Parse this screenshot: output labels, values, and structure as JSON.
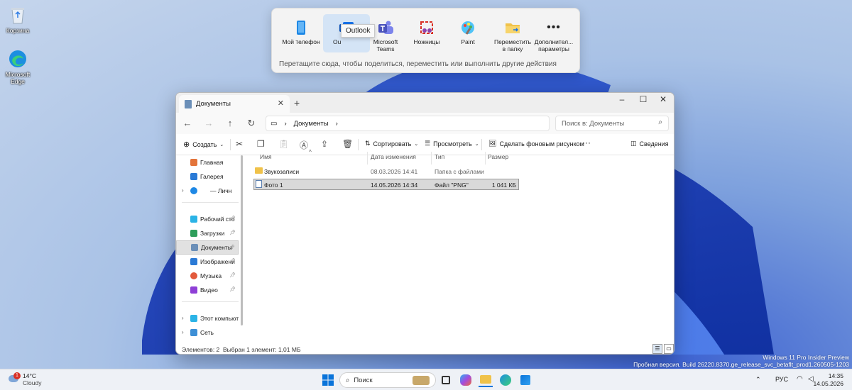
{
  "desktop": {
    "icons": [
      {
        "label": "Корзина",
        "icon": "recycle-bin-icon"
      },
      {
        "label": "Microsoft Edge",
        "icon": "edge-icon"
      }
    ],
    "watermark": {
      "line1": "Windows 11 Pro Insider Preview",
      "line2": "Пробная версия. Build 26220.8370.ge_release_svc_betaflt_prod1.260505-1203"
    }
  },
  "share": {
    "targets": [
      {
        "label": "Мой телефон",
        "icon": "phone-icon"
      },
      {
        "label": "Outlook",
        "icon": "outlook-icon",
        "selected": true
      },
      {
        "label": "Microsoft Teams",
        "icon": "teams-icon"
      },
      {
        "label": "Ножницы",
        "icon": "scissors-icon"
      },
      {
        "label": "Paint",
        "icon": "paint-icon"
      },
      {
        "label": "Переместить в папку",
        "icon": "folder-icon"
      },
      {
        "label": "Дополнительные параметры",
        "icon": "more-icon"
      }
    ],
    "short_label_outlook": "Ou",
    "label_more_line1": "Дополнител...",
    "label_more_line2": "параметры",
    "label_teams_line1": "Microsoft",
    "label_teams_line2": "Teams",
    "label_move_line1": "Переместить",
    "label_move_line2": "в папку",
    "tooltip": "Outlook",
    "hint": "Перетащите сюда, чтобы поделиться, переместить или выполнить другие действия"
  },
  "explorer": {
    "tab_title": "Документы",
    "breadcrumb": "Документы",
    "search_placeholder": "Поиск в: Документы",
    "toolbar": {
      "create": "Создать",
      "sort": "Сортировать",
      "view": "Просмотреть",
      "set_wallpaper": "Сделать фоновым рисунком",
      "details": "Сведения"
    },
    "sidebar": {
      "items": [
        {
          "label": "Главная",
          "icon": "home-icon"
        },
        {
          "label": "Галерея",
          "icon": "gallery-icon"
        },
        {
          "label": "— Личн",
          "icon": "onedrive-icon"
        },
        {
          "label": "Рабочий сто",
          "icon": "desktop-icon"
        },
        {
          "label": "Загрузки",
          "icon": "download-icon"
        },
        {
          "label": "Документы",
          "icon": "documents-icon",
          "selected": true
        },
        {
          "label": "Изображени",
          "icon": "pictures-icon"
        },
        {
          "label": "Музыка",
          "icon": "music-icon"
        },
        {
          "label": "Видео",
          "icon": "video-icon"
        },
        {
          "label": "Этот компьюте",
          "icon": "computer-icon"
        },
        {
          "label": "Сеть",
          "icon": "network-icon"
        }
      ]
    },
    "columns": [
      "Имя",
      "Дата изменения",
      "Тип",
      "Размер"
    ],
    "files": [
      {
        "name": "Звукозаписи",
        "date": "08.03.2026 14:41",
        "type": "Папка с файлами",
        "size": ""
      },
      {
        "name": "Фото 1",
        "date": "14.05.2026 14:34",
        "type": "Файл \"PNG\"",
        "size": "1 041 КБ",
        "selected": true
      }
    ],
    "status": {
      "count": "Элементов: 2",
      "selected": "Выбран 1 элемент: 1,01 МБ"
    }
  },
  "taskbar": {
    "weather": {
      "temp": "14°C",
      "condition": "Cloudy",
      "badge": "1"
    },
    "search_label": "Поиск",
    "language": "РУС",
    "time": "14:35",
    "date": "14.05.2026"
  },
  "colors": {
    "accent": "#0067c0",
    "folder": "#f0c24a",
    "selection": "#d9d9d9"
  }
}
